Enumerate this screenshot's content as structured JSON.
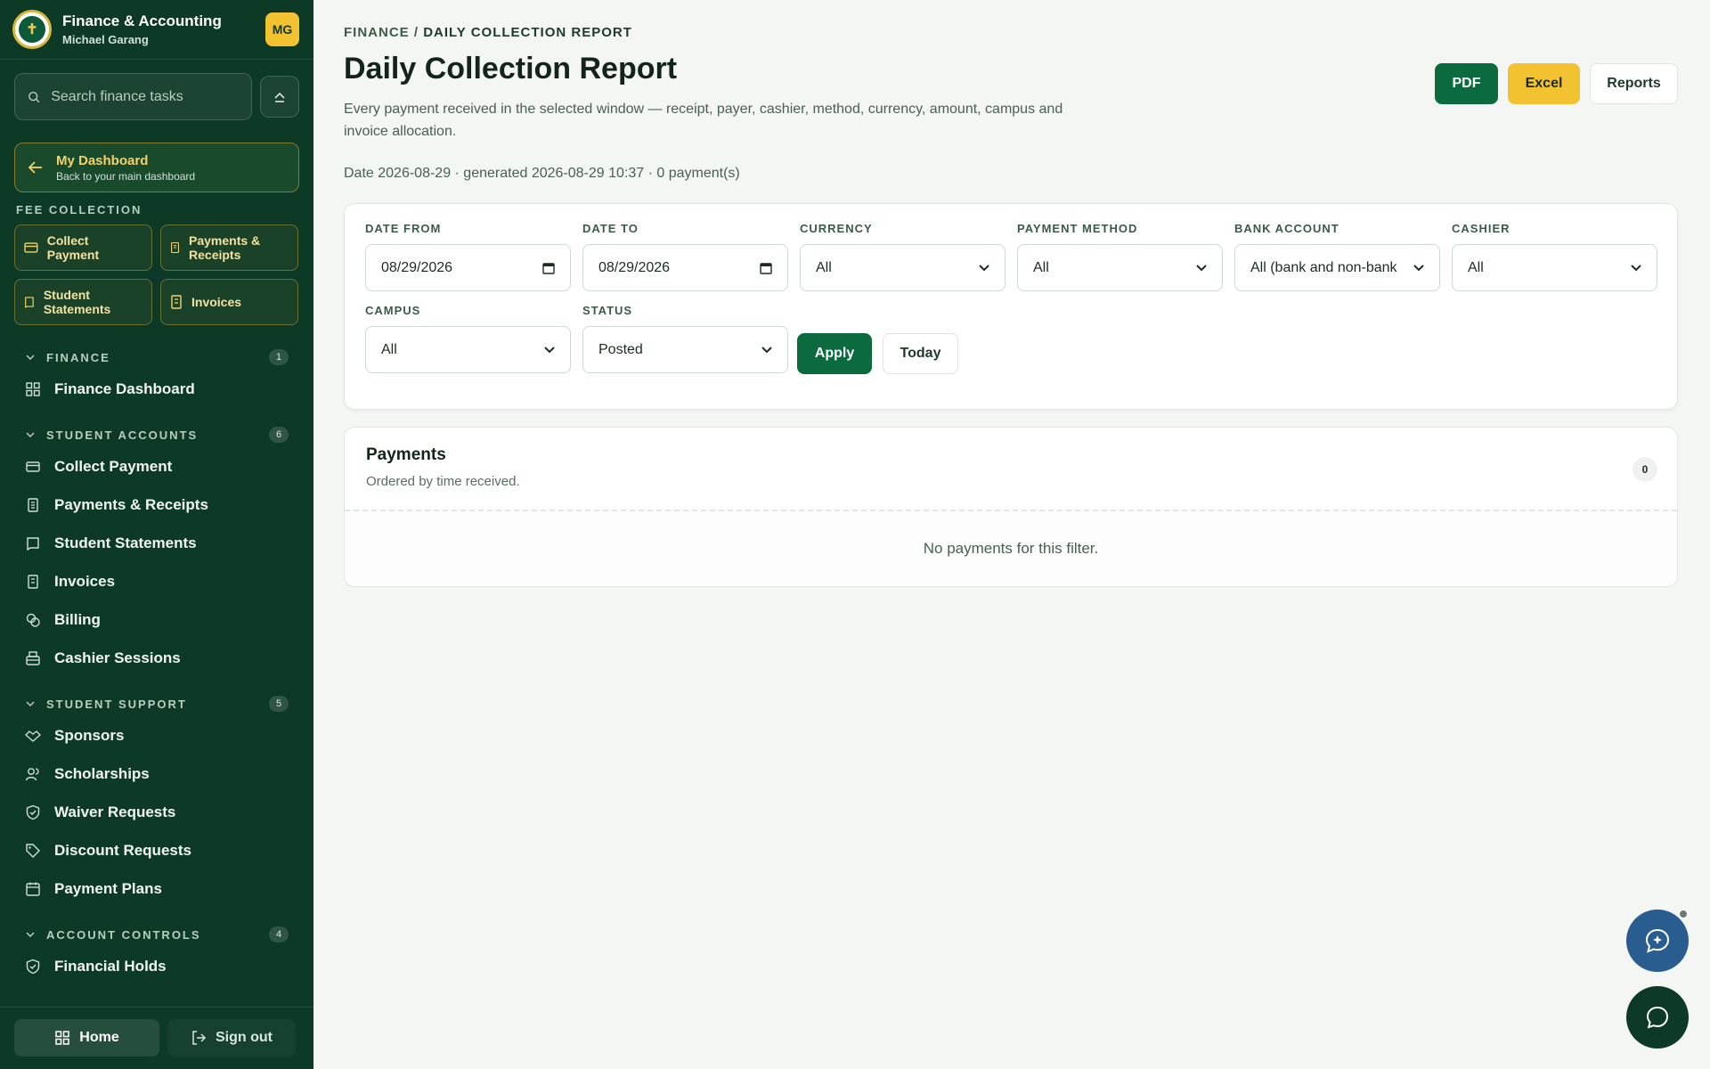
{
  "app": {
    "title": "Finance & Accounting",
    "user": "Michael Garang",
    "initials": "MG"
  },
  "search": {
    "placeholder": "Search finance tasks"
  },
  "dashboard": {
    "title": "My Dashboard",
    "subtitle": "Back to your main dashboard"
  },
  "fee_collection": {
    "label": "FEE COLLECTION",
    "items": [
      {
        "label": "Collect Payment",
        "icon": "card-icon"
      },
      {
        "label": "Payments & Receipts",
        "icon": "receipt-icon"
      },
      {
        "label": "Student Statements",
        "icon": "book-icon"
      },
      {
        "label": "Invoices",
        "icon": "invoice-icon"
      }
    ]
  },
  "nav": {
    "finance": {
      "label": "FINANCE",
      "count": "1",
      "items": [
        {
          "label": "Finance Dashboard"
        }
      ]
    },
    "student_accounts": {
      "label": "STUDENT ACCOUNTS",
      "count": "6",
      "items": [
        {
          "label": "Collect Payment"
        },
        {
          "label": "Payments & Receipts"
        },
        {
          "label": "Student Statements"
        },
        {
          "label": "Invoices"
        },
        {
          "label": "Billing"
        },
        {
          "label": "Cashier Sessions"
        }
      ]
    },
    "student_support": {
      "label": "STUDENT SUPPORT",
      "count": "5",
      "items": [
        {
          "label": "Sponsors"
        },
        {
          "label": "Scholarships"
        },
        {
          "label": "Waiver Requests"
        },
        {
          "label": "Discount Requests"
        },
        {
          "label": "Payment Plans"
        }
      ]
    },
    "account_controls": {
      "label": "ACCOUNT CONTROLS",
      "count": "4",
      "items": [
        {
          "label": "Financial Holds"
        }
      ]
    }
  },
  "footer": {
    "home": "Home",
    "signout": "Sign out"
  },
  "page": {
    "breadcrumb_root": "FINANCE",
    "breadcrumb_sep": " / ",
    "breadcrumb_current": "DAILY COLLECTION REPORT",
    "title": "Daily Collection Report",
    "description": "Every payment received in the selected window — receipt, payer, cashier, method, currency, amount, campus and invoice allocation.",
    "meta": "Date 2026-08-29 · generated 2026-08-29 10:37 · 0 payment(s)"
  },
  "actions": {
    "pdf": "PDF",
    "excel": "Excel",
    "reports": "Reports"
  },
  "filters": {
    "date_from": {
      "label": "DATE FROM",
      "value": "08/29/2026"
    },
    "date_to": {
      "label": "DATE TO",
      "value": "08/29/2026"
    },
    "currency": {
      "label": "CURRENCY",
      "value": "All"
    },
    "payment_method": {
      "label": "PAYMENT METHOD",
      "value": "All"
    },
    "bank_account": {
      "label": "BANK ACCOUNT",
      "value": "All (bank and non-bank"
    },
    "cashier": {
      "label": "CASHIER",
      "value": "All"
    },
    "campus": {
      "label": "CAMPUS",
      "value": "All"
    },
    "status": {
      "label": "STATUS",
      "value": "Posted"
    },
    "apply": "Apply",
    "today": "Today"
  },
  "payments": {
    "title": "Payments",
    "subtitle": "Ordered by time received.",
    "count": "0",
    "empty": "No payments for this filter."
  },
  "colors": {
    "sidebar": "#0d3a26",
    "primary": "#0b6b3f",
    "accent": "#f2c230",
    "ai_fab": "#2a5d8f"
  }
}
